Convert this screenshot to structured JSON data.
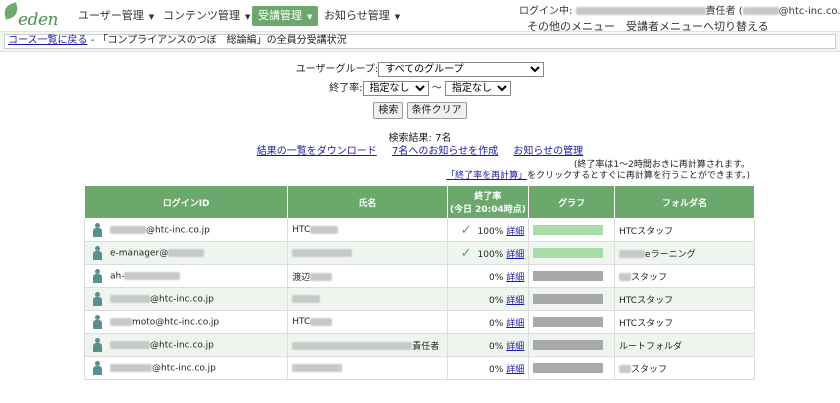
{
  "header": {
    "logo_text": "eden",
    "menus": [
      {
        "label": "ユーザー管理"
      },
      {
        "label": "コンテンツ管理"
      },
      {
        "label": "受講管理"
      },
      {
        "label": "お知らせ管理"
      }
    ],
    "login_prefix": "ログイン中:",
    "login_name_suffix": "責任者",
    "login_email_suffix": "@htc-inc.co.jp)",
    "other_menu": "その他のメニュー",
    "switch_menu": "受講者メニューへ切り替える"
  },
  "breadcrumb": {
    "link": "コース一覧に戻る",
    "title": "- 「コンプライアンスのつぼ　総論編」の全員分受講状況"
  },
  "filters": {
    "group_label": "ユーザーグループ:",
    "group_selected": "すべてのグループ",
    "rate_label": "終了率:",
    "rate_from": "指定なし",
    "tilde": "〜",
    "rate_to": "指定なし",
    "search_button": "検索",
    "clear_button": "条件クリア"
  },
  "results": {
    "count_text": "検索結果: 7名",
    "download_link": "結果の一覧をダウンロード",
    "notify_link": "7名へのお知らせを作成",
    "manage_link": "お知らせの管理",
    "note_line1": "(終了率は1〜2時間おきに再計算されます。",
    "recalc_link": "「終了率を再計算」",
    "note_line2": "をクリックするとすぐに再計算を行うことができます。)"
  },
  "table": {
    "headers": {
      "login_id": "ログインID",
      "name": "氏名",
      "rate": "終了率",
      "rate_sub": "(今日 20:04時点)",
      "graph": "グラフ",
      "folder": "フォルダ名"
    },
    "detail_label": "詳細",
    "rows": [
      {
        "login": "@htc-inc.co.jp",
        "name": "HTC",
        "rate": "100%",
        "progress": 1.0,
        "done": true,
        "folder": "HTCスタッフ"
      },
      {
        "login": "e-manager@",
        "name": "",
        "rate": "100%",
        "progress": 1.0,
        "done": true,
        "folder": "eラーニング"
      },
      {
        "login": "ah-",
        "name": "渡辺",
        "rate": "0%",
        "progress": 0.0,
        "done": false,
        "folder": "スタッフ"
      },
      {
        "login": "@htc-inc.co.jp",
        "name": "",
        "rate": "0%",
        "progress": 0.0,
        "done": false,
        "folder": "HTCスタッフ"
      },
      {
        "login": "moto@htc-inc.co.jp",
        "name": "HTC",
        "rate": "0%",
        "progress": 0.0,
        "done": false,
        "folder": "HTCスタッフ"
      },
      {
        "login": "@htc-inc.co.jp",
        "name": "責任者",
        "rate": "0%",
        "progress": 0.0,
        "done": false,
        "folder": "ルートフォルダ"
      },
      {
        "login": "@htc-inc.co.jp",
        "name": "",
        "rate": "0%",
        "progress": 0.0,
        "done": false,
        "folder": "スタッフ"
      }
    ]
  }
}
